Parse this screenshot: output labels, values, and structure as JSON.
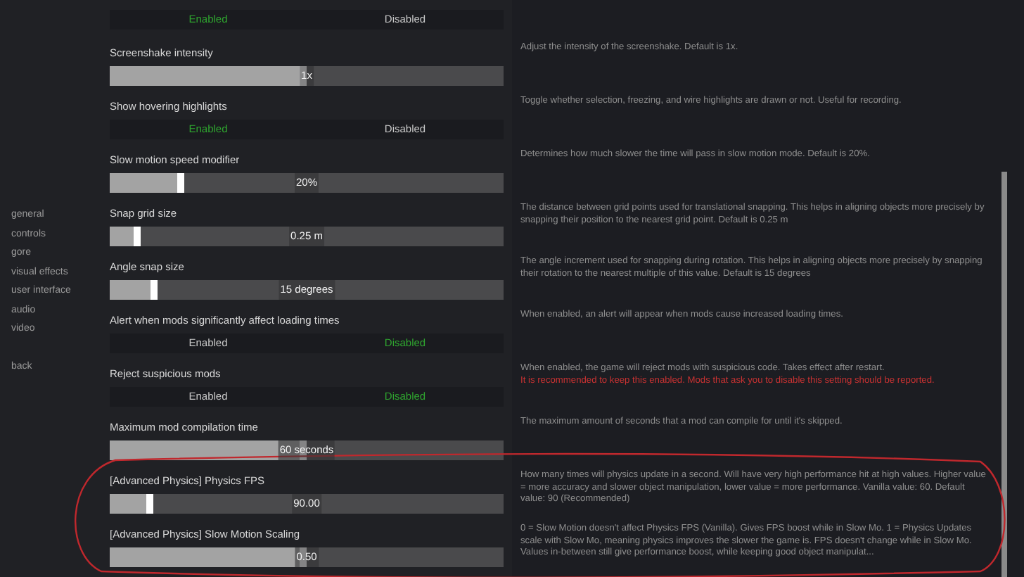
{
  "sidebar": {
    "items": [
      {
        "label": "general"
      },
      {
        "label": "controls"
      },
      {
        "label": "gore"
      },
      {
        "label": "visual effects"
      },
      {
        "label": "user interface"
      },
      {
        "label": "audio"
      },
      {
        "label": "video"
      }
    ],
    "back": "back"
  },
  "settings": [
    {
      "kind": "toggle",
      "options": [
        {
          "label": "Enabled",
          "selected": true
        },
        {
          "label": "Disabled",
          "selected": false
        }
      ]
    },
    {
      "kind": "slider",
      "label": "Screenshake intensity",
      "value": "1x",
      "level": 0.5,
      "description": [
        {
          "text": "Adjust the intensity of the screenshake. Default is 1x.",
          "warning": false
        }
      ]
    },
    {
      "kind": "toggle",
      "label": "Show hovering highlights",
      "options": [
        {
          "label": "Enabled",
          "selected": true
        },
        {
          "label": "Disabled",
          "selected": false
        }
      ],
      "description": [
        {
          "text": "Toggle whether selection, freezing, and wire highlights are drawn or not. Useful for recording.",
          "warning": false
        }
      ]
    },
    {
      "kind": "slider",
      "label": "Slow motion speed modifier",
      "value": "20%",
      "level": 0.19,
      "description": [
        {
          "text": "Determines how much slower the time will pass in slow motion mode. Default is 20%.",
          "warning": false
        }
      ]
    },
    {
      "kind": "slider",
      "label": "Snap grid size",
      "value": "0.25 m",
      "level": 0.08,
      "description": [
        {
          "text": "The distance between grid points used for translational snapping. This helps in aligning objects more precisely by snapping their position to the nearest grid point. Default is 0.25 m",
          "warning": false
        }
      ]
    },
    {
      "kind": "slider",
      "label": "Angle snap size",
      "value": "15 degrees",
      "level": 0.12,
      "description": [
        {
          "text": "The angle increment used for snapping during rotation. This helps in aligning objects more precisely by snapping their rotation to the nearest multiple of this value. Default is 15 degrees",
          "warning": false
        }
      ]
    },
    {
      "kind": "toggle",
      "label": "Alert when mods significantly affect loading times",
      "options": [
        {
          "label": "Enabled",
          "selected": false
        },
        {
          "label": "Disabled",
          "selected": true
        }
      ],
      "description": [
        {
          "text": "When enabled, an alert will appear when mods cause increased loading times.",
          "warning": false
        }
      ]
    },
    {
      "kind": "toggle",
      "label": "Reject suspicious mods",
      "options": [
        {
          "label": "Enabled",
          "selected": false
        },
        {
          "label": "Disabled",
          "selected": true
        }
      ],
      "description": [
        {
          "text": "When enabled, the game will reject mods with suspicious code. Takes effect after restart.",
          "warning": false
        },
        {
          "text": "It is recommended to keep this enabled. Mods that ask you to disable this setting should be reported.",
          "warning": true
        }
      ]
    },
    {
      "kind": "slider",
      "label": "Maximum mod compilation time",
      "value": "60 seconds",
      "level": 0.5,
      "description": [
        {
          "text": "The maximum amount of seconds that a mod can compile for until it's skipped.",
          "warning": false
        }
      ]
    },
    {
      "kind": "slider",
      "label": "[Advanced Physics] Physics FPS",
      "value": "90.00",
      "level": 0.11,
      "description": [
        {
          "text": "How many times will physics update in a second. Will have very high performance hit at high values. Higher value = more accuracy and slower object manipulation, lower value = more performance. Vanilla value: 60. Default value: 90 (Recommended)",
          "warning": false
        }
      ]
    },
    {
      "kind": "slider",
      "label": "[Advanced Physics] Slow Motion Scaling",
      "value": "0.50",
      "level": 0.5,
      "description": [
        {
          "text": "0 = Slow Motion doesn't affect Physics FPS (Vanilla). Gives FPS boost while in Slow Mo. 1 = Physics Updates scale with Slow Mo, meaning physics improves the slower the game is. FPS doesn't change while in Slow Mo. Values in-between still give performance boost, while keeping good object manipulat...",
          "warning": false
        }
      ]
    }
  ],
  "annotations": [
    {
      "kind": "ellipse"
    }
  ]
}
